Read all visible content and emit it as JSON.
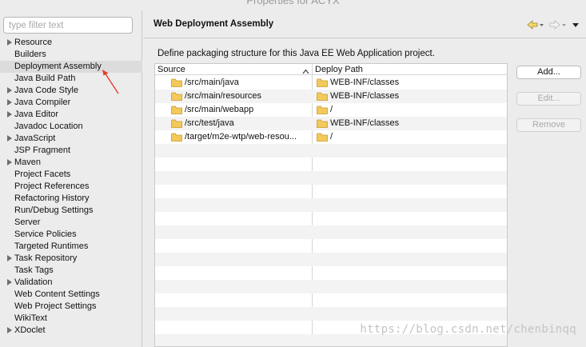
{
  "window": {
    "title": "Properties for ACYX"
  },
  "filter": {
    "placeholder": "type filter text"
  },
  "nav": {
    "items": [
      {
        "label": "Resource",
        "expandable": true,
        "selected": false
      },
      {
        "label": "Builders",
        "expandable": false,
        "selected": false
      },
      {
        "label": "Deployment Assembly",
        "expandable": false,
        "selected": true
      },
      {
        "label": "Java Build Path",
        "expandable": false,
        "selected": false
      },
      {
        "label": "Java Code Style",
        "expandable": true,
        "selected": false
      },
      {
        "label": "Java Compiler",
        "expandable": true,
        "selected": false
      },
      {
        "label": "Java Editor",
        "expandable": true,
        "selected": false
      },
      {
        "label": "Javadoc Location",
        "expandable": false,
        "selected": false
      },
      {
        "label": "JavaScript",
        "expandable": true,
        "selected": false
      },
      {
        "label": "JSP Fragment",
        "expandable": false,
        "selected": false
      },
      {
        "label": "Maven",
        "expandable": true,
        "selected": false
      },
      {
        "label": "Project Facets",
        "expandable": false,
        "selected": false
      },
      {
        "label": "Project References",
        "expandable": false,
        "selected": false
      },
      {
        "label": "Refactoring History",
        "expandable": false,
        "selected": false
      },
      {
        "label": "Run/Debug Settings",
        "expandable": false,
        "selected": false
      },
      {
        "label": "Server",
        "expandable": false,
        "selected": false
      },
      {
        "label": "Service Policies",
        "expandable": false,
        "selected": false
      },
      {
        "label": "Targeted Runtimes",
        "expandable": false,
        "selected": false
      },
      {
        "label": "Task Repository",
        "expandable": true,
        "selected": false
      },
      {
        "label": "Task Tags",
        "expandable": false,
        "selected": false
      },
      {
        "label": "Validation",
        "expandable": true,
        "selected": false
      },
      {
        "label": "Web Content Settings",
        "expandable": false,
        "selected": false
      },
      {
        "label": "Web Project Settings",
        "expandable": false,
        "selected": false
      },
      {
        "label": "WikiText",
        "expandable": false,
        "selected": false
      },
      {
        "label": "XDoclet",
        "expandable": true,
        "selected": false
      }
    ]
  },
  "page": {
    "title": "Web Deployment Assembly",
    "description": "Define packaging structure for this Java EE Web Application project."
  },
  "table": {
    "columns": {
      "source": "Source",
      "deploy": "Deploy Path"
    },
    "rows": [
      {
        "source": "/src/main/java",
        "deploy": "WEB-INF/classes"
      },
      {
        "source": "/src/main/resources",
        "deploy": "WEB-INF/classes"
      },
      {
        "source": "/src/main/webapp",
        "deploy": "/"
      },
      {
        "source": "/src/test/java",
        "deploy": "WEB-INF/classes"
      },
      {
        "source": "/target/m2e-wtp/web-resou...",
        "deploy": "/"
      }
    ],
    "empty_rows": 15
  },
  "buttons": {
    "add": {
      "label": "Add...",
      "enabled": true
    },
    "edit": {
      "label": "Edit...",
      "enabled": false
    },
    "remove": {
      "label": "Remove",
      "enabled": false
    }
  },
  "watermark": "https://blog.csdn.net/chenbinqq",
  "colors": {
    "folder_fill": "#f2c95a",
    "folder_stroke": "#c99a2a",
    "annotation_arrow": "#e4402b",
    "selected_bg": "#dcdcdc"
  },
  "icons": {
    "back": "back-arrow-icon",
    "forward": "forward-arrow-icon",
    "menu": "view-menu-icon",
    "folder": "folder-icon",
    "sort": "sort-ascending-icon"
  }
}
